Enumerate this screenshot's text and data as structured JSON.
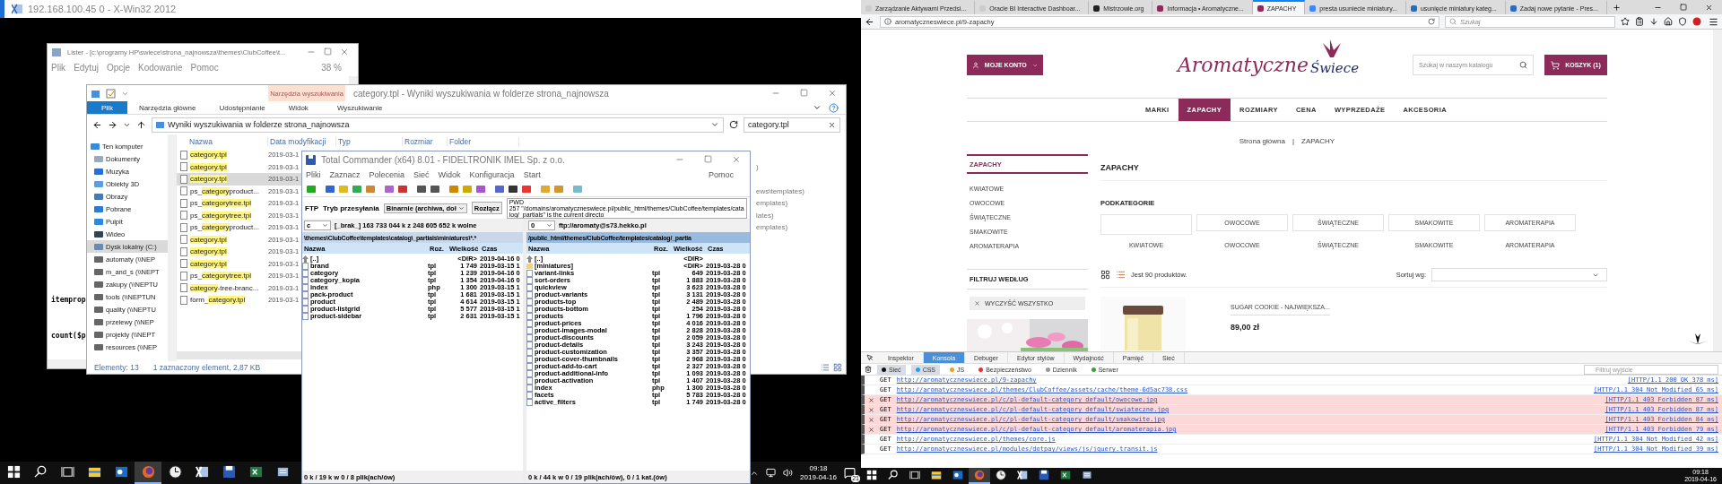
{
  "left_screen": {
    "xwin_title": "192.168.100.45 0 - X-Win32 2012",
    "lister": {
      "title": "Lister - [c:\\programy HP\\swiece\\strona_najnowsza\\themes\\ClubCoffee\\t...",
      "menu": [
        "Plik",
        "Edytuj",
        "Opcje",
        "Kodowanie",
        "Pomoc"
      ],
      "zoom": "38 %",
      "lines": [
        "itemprop",
        "count($p"
      ]
    },
    "explorer": {
      "title": "category.tpl - Wyniki wyszukiwania w folderze strona_najnowsza",
      "context_group": "Narzędzia wyszukiwania",
      "ribbon_tabs": [
        {
          "label": "Plik",
          "selected": true
        },
        {
          "label": "Narzędzia główne",
          "selected": false
        },
        {
          "label": "Udostępnianie",
          "selected": false
        },
        {
          "label": "Widok",
          "selected": false
        },
        {
          "label": "Wyszukiwanie",
          "selected": false
        }
      ],
      "address": "Wyniki wyszukiwania w folderze strona_najnowsza",
      "search": "category.tpl",
      "nav": [
        {
          "label": "Ten komputer",
          "kind": "pc",
          "selected": false,
          "children": [
            {
              "label": "Dokumenty",
              "kind": "docs",
              "selected": false
            },
            {
              "label": "Muzyka",
              "kind": "music",
              "selected": false
            },
            {
              "label": "Obiekty 3D",
              "kind": "cube",
              "selected": false
            },
            {
              "label": "Obrazy",
              "kind": "pictures",
              "selected": false
            },
            {
              "label": "Pobrane",
              "kind": "downloads",
              "selected": false
            },
            {
              "label": "Pulpit",
              "kind": "desktop",
              "selected": false
            },
            {
              "label": "Wideo",
              "kind": "video",
              "selected": false
            },
            {
              "label": "Dysk lokalny (C:)",
              "kind": "drive",
              "selected": true
            },
            {
              "label": "automaty (\\\\NEP",
              "kind": "network",
              "selected": false
            },
            {
              "label": "m_and_s (\\\\NEPT",
              "kind": "network",
              "selected": false
            },
            {
              "label": "zakupy (\\\\NEPTU",
              "kind": "network",
              "selected": false
            },
            {
              "label": "tools (\\\\NEPTUN",
              "kind": "network",
              "selected": false
            },
            {
              "label": "quality (\\\\NEPTU",
              "kind": "network",
              "selected": false
            },
            {
              "label": "przelewy (\\\\NEP",
              "kind": "network",
              "selected": false
            },
            {
              "label": "projekty (\\\\NEPT",
              "kind": "network",
              "selected": false
            },
            {
              "label": "resources (\\\\NEP",
              "kind": "network",
              "selected": false
            }
          ]
        }
      ],
      "columns": [
        "Nazwa",
        "Data modyfikacji",
        "Typ",
        "Rozmiar",
        "Folder"
      ],
      "rows": [
        {
          "name": [
            {
              "text": "category.tpl",
              "hl": true
            }
          ],
          "date": "2019-03-1",
          "selected": false
        },
        {
          "name": [
            {
              "text": "category.tpl",
              "hl": true
            }
          ],
          "date": "2019-03-1",
          "folder_tail": ")",
          "selected": false
        },
        {
          "name": [
            {
              "text": "category.tpl",
              "hl": true
            }
          ],
          "date": "2019-03-1",
          "selected": true
        },
        {
          "name": [
            {
              "text": "ps_",
              "hl": false
            },
            {
              "text": "category",
              "hl": true
            },
            {
              "text": "product...",
              "hl": false
            }
          ],
          "date": "2019-03-1",
          "folder_tail": "ews\\templates)",
          "selected": false
        },
        {
          "name": [
            {
              "text": "ps_",
              "hl": false
            },
            {
              "text": "categorytree.tpl",
              "hl": true
            }
          ],
          "date": "2019-03-1",
          "folder_tail": "emplates)",
          "selected": false
        },
        {
          "name": [
            {
              "text": "ps_",
              "hl": false
            },
            {
              "text": "categorytree.tpl",
              "hl": true
            }
          ],
          "date": "2019-03-1",
          "folder_tail": "lates)",
          "selected": false
        },
        {
          "name": [
            {
              "text": "ps_",
              "hl": false
            },
            {
              "text": "category",
              "hl": true
            },
            {
              "text": "product...",
              "hl": false
            }
          ],
          "date": "2019-03-1",
          "folder_tail": "emplates)",
          "selected": false
        },
        {
          "name": [
            {
              "text": "category.tpl",
              "hl": true
            }
          ],
          "date": "2019-03-1",
          "selected": false
        },
        {
          "name": [
            {
              "text": "category.tpl",
              "hl": true
            }
          ],
          "date": "2019-03-1",
          "selected": false
        },
        {
          "name": [
            {
              "text": "category.tpl",
              "hl": true
            }
          ],
          "date": "2019-03-1",
          "selected": false
        },
        {
          "name": [
            {
              "text": "ps_",
              "hl": false
            },
            {
              "text": "categorytree.tpl",
              "hl": true
            }
          ],
          "date": "2019-03-1",
          "selected": false
        },
        {
          "name": [
            {
              "text": "category",
              "hl": true
            },
            {
              "text": "-tree-branc...",
              "hl": false
            }
          ],
          "date": "2019-03-1",
          "selected": false
        },
        {
          "name": [
            {
              "text": "form_",
              "hl": false
            },
            {
              "text": "category.tpl",
              "hl": true
            }
          ],
          "date": "2019-03-1",
          "selected": false
        }
      ],
      "status": [
        "Elementy: 13",
        "1 zaznaczony element, 2,87 KB"
      ]
    },
    "total_commander": {
      "title": "Total Commander (x64) 8.01 - FIDELTRONIK IMEL Sp. z o.o.",
      "menu": [
        "Pliki",
        "Zaznacz",
        "Polecenia",
        "Sieć",
        "Widok",
        "Konfiguracja",
        "Start"
      ],
      "help": "Pomoc",
      "ftp": {
        "label": "FTP",
        "mode_label": "Tryb przesyłania",
        "mode": "Binarnie (archiwa, doł",
        "disconnect": "Rozłącz",
        "log": [
          "PWD",
          "257 \"/domains/aromatyczneswiece.pl/public_html/themes/ClubCoffee/templates/catalog/_partials\" is the current directo"
        ]
      },
      "panels": [
        {
          "drive": "c",
          "info": "[_brak_]  163 733 044 k z 248 605 652 k wolne",
          "path": "\\themes\\ClubCoffee\\templates\\catalog\\_partials\\miniatures\\*.*",
          "active": false,
          "columns": [
            "Nazwa",
            "Roz.",
            "Wielkość",
            "Czas"
          ],
          "files": [
            {
              "name": "[..]",
              "kind": "up",
              "size": "<DIR>",
              "time": "2019-04-16 0"
            },
            {
              "name": "brand",
              "kind": "file",
              "ext": "tpl",
              "size": "1 749",
              "time": "2019-03-15 1"
            },
            {
              "name": "category",
              "kind": "file",
              "ext": "tpl",
              "size": "1 239",
              "time": "2019-04-16 0"
            },
            {
              "name": "category_kopia",
              "kind": "file",
              "ext": "tpl",
              "size": "1 354",
              "time": "2019-04-16 0"
            },
            {
              "name": "index",
              "kind": "file",
              "ext": "php",
              "size": "1 300",
              "time": "2019-03-15 1"
            },
            {
              "name": "pack-product",
              "kind": "file",
              "ext": "tpl",
              "size": "1 681",
              "time": "2019-03-15 1"
            },
            {
              "name": "product",
              "kind": "file",
              "ext": "tpl",
              "size": "4 614",
              "time": "2019-03-15 1"
            },
            {
              "name": "product-listgrid",
              "kind": "file",
              "ext": "tpl",
              "size": "5 577",
              "time": "2019-03-15 1"
            },
            {
              "name": "product-sidebar",
              "kind": "file",
              "ext": "tpl",
              "size": "2 631",
              "time": "2019-03-15 1"
            }
          ],
          "status": "0 k / 19 k w 0 / 8 plik(ach/ów)"
        },
        {
          "drive": "0",
          "info": "ftp://aromaty@s73.hekko.pl",
          "path": "/public_html/themes/ClubCoffee/templates/catalog/_partia",
          "active": true,
          "columns": [
            "Nazwa",
            "Roz.",
            "Wielkość",
            "Czas"
          ],
          "files": [
            {
              "name": "[..]",
              "kind": "up",
              "size": "<DIR>"
            },
            {
              "name": "[miniatures]",
              "kind": "folder",
              "size": "<DIR>",
              "time": "2019-03-28 0"
            },
            {
              "name": "variant-links",
              "kind": "file",
              "ext": "tpl",
              "size": "649",
              "time": "2019-03-28 0"
            },
            {
              "name": "sort-orders",
              "kind": "file",
              "ext": "tpl",
              "size": "1 883",
              "time": "2019-03-28 0"
            },
            {
              "name": "quickview",
              "kind": "file",
              "ext": "tpl",
              "size": "3 623",
              "time": "2019-03-28 0"
            },
            {
              "name": "product-variants",
              "kind": "file",
              "ext": "tpl",
              "size": "3 131",
              "time": "2019-03-28 0"
            },
            {
              "name": "products-top",
              "kind": "file",
              "ext": "tpl",
              "size": "2 489",
              "time": "2019-03-28 0"
            },
            {
              "name": "products-bottom",
              "kind": "file",
              "ext": "tpl",
              "size": "254",
              "time": "2019-03-28 0"
            },
            {
              "name": "products",
              "kind": "file",
              "ext": "tpl",
              "size": "1 796",
              "time": "2019-03-28 0"
            },
            {
              "name": "product-prices",
              "kind": "file",
              "ext": "tpl",
              "size": "4 016",
              "time": "2019-03-28 0"
            },
            {
              "name": "product-images-modal",
              "kind": "file",
              "ext": "tpl",
              "size": "2 828",
              "time": "2019-03-28 0"
            },
            {
              "name": "product-discounts",
              "kind": "file",
              "ext": "tpl",
              "size": "2 059",
              "time": "2019-03-28 0"
            },
            {
              "name": "product-details",
              "kind": "file",
              "ext": "tpl",
              "size": "3 243",
              "time": "2019-03-28 0"
            },
            {
              "name": "product-customization",
              "kind": "file",
              "ext": "tpl",
              "size": "3 357",
              "time": "2019-03-28 0"
            },
            {
              "name": "product-cover-thumbnails",
              "kind": "file",
              "ext": "tpl",
              "size": "2 968",
              "time": "2019-03-28 0"
            },
            {
              "name": "product-add-to-cart",
              "kind": "file",
              "ext": "tpl",
              "size": "2 327",
              "time": "2019-03-28 0"
            },
            {
              "name": "product-additional-info",
              "kind": "file",
              "ext": "tpl",
              "size": "1 093",
              "time": "2019-03-28 0"
            },
            {
              "name": "product-activation",
              "kind": "file",
              "ext": "tpl",
              "size": "1 407",
              "time": "2019-03-28 0"
            },
            {
              "name": "index",
              "kind": "file",
              "ext": "php",
              "size": "1 300",
              "time": "2019-03-28 0"
            },
            {
              "name": "facets",
              "kind": "file",
              "ext": "tpl",
              "size": "5 783",
              "time": "2019-03-28 0"
            },
            {
              "name": "active_filters",
              "kind": "file",
              "ext": "tpl",
              "size": "1 749",
              "time": "2019-03-28 0"
            }
          ],
          "status": "0 k / 44 k w 0 / 19 plik(ach/ów), 0 / 1 kat.(ów)"
        }
      ]
    },
    "taskbar": {
      "apps": [
        {
          "kind": "start",
          "selected": false
        },
        {
          "kind": "search",
          "selected": false
        },
        {
          "kind": "taskview",
          "selected": false
        },
        {
          "kind": "explorer",
          "selected": false
        },
        {
          "kind": "outlook",
          "selected": false
        },
        {
          "kind": "firefox",
          "selected": true
        },
        {
          "kind": "clock",
          "selected": false
        },
        {
          "kind": "xwin",
          "selected": false
        },
        {
          "kind": "tc",
          "selected": false
        },
        {
          "kind": "excel",
          "selected": false
        },
        {
          "kind": "lister",
          "selected": false
        }
      ],
      "time": "09:18",
      "date": "2019-04-16",
      "notifications": "21"
    }
  },
  "browser": {
    "tabs": [
      {
        "label": "Zarządzanie Aktywami Przedsi...",
        "selected": false,
        "color": "#cccccc"
      },
      {
        "label": "Oracle BI Interactive Dashboar...",
        "selected": false,
        "color": "#cccccc"
      },
      {
        "label": "Mistrzowie.org",
        "selected": false,
        "color": "#222222"
      },
      {
        "label": "Informacja • Aromatyczne...",
        "selected": false,
        "color": "#8c2a5a"
      },
      {
        "label": "ZAPACHY",
        "selected": true,
        "color": "#8c2a5a"
      },
      {
        "label": "presta usuniecie miniatury...",
        "selected": false,
        "color": "#4285f4"
      },
      {
        "label": "usunięcie miniatury kateg...",
        "selected": false,
        "color": "#2a6ebb"
      },
      {
        "label": "Zadaj nowe pytanie - Pres...",
        "selected": false,
        "color": "#2a6ebb"
      }
    ],
    "url": "aromatyczneswiece.pl/9-zapachy",
    "search_placeholder": "Szukaj",
    "page": {
      "account": "MOJE KONTO",
      "logo": [
        "Aromatyczne",
        "Świece"
      ],
      "search_placeholder": "Szukaj w naszym katalogu",
      "cart": "KOSZYK (1)",
      "nav": [
        {
          "label": "MARKI",
          "selected": false
        },
        {
          "label": "ZAPACHY",
          "selected": true
        },
        {
          "label": "ROZMIARY",
          "selected": false
        },
        {
          "label": "CENA",
          "selected": false
        },
        {
          "label": "WYPRZEDAŻE",
          "selected": false
        },
        {
          "label": "AKCESORIA",
          "selected": false
        }
      ],
      "breadcrumb": {
        "items": [
          "Strona główna",
          "ZAPACHY"
        ],
        "separator": "|"
      },
      "sidebar": {
        "title": "ZAPACHY",
        "items": [
          "KWIATOWE",
          "OWOCOWE",
          "ŚWIĄTECZNE",
          "SMAKOWITE",
          "AROMATERAPIA"
        ],
        "filter_title": "FILTRUJ WEDŁUG",
        "clear": "WYCZYŚĆ WSZYSTKO"
      },
      "title": "ZAPACHY",
      "subcategories_title": "PODKATEGORIE",
      "subcategories": [
        {
          "name": "KWIATOWE"
        },
        {
          "name": "OWOCOWE",
          "alt": "OWOCOWE"
        },
        {
          "name": "ŚWIĄTECZNE",
          "alt": "ŚWIĄTECZNE"
        },
        {
          "name": "SMAKOWITE",
          "alt": "SMAKOWITE"
        },
        {
          "name": "AROMATERAPIA",
          "alt": "AROMATERAPIA"
        }
      ],
      "count": "Jest 90 produktów.",
      "sort_label": "Sortuj wg:",
      "product": {
        "name": "SUGAR COOKIE - NAJWIĘKSZA...",
        "price": "89,00 zł"
      }
    },
    "devtools": {
      "tabs": [
        {
          "label": "Inspektor",
          "selected": false
        },
        {
          "label": "Konsola",
          "selected": true
        },
        {
          "label": "Debuger",
          "selected": false
        },
        {
          "label": "Edytor stylów",
          "selected": false
        },
        {
          "label": "Wydajność",
          "selected": false
        },
        {
          "label": "Pamięć",
          "selected": false
        },
        {
          "label": "Sieć",
          "selected": false
        }
      ],
      "filters": [
        {
          "label": "Sieć",
          "on": true,
          "color": "#111111"
        },
        {
          "label": "CSS",
          "on": true,
          "color": "#2a9ee8"
        },
        {
          "label": "JS",
          "on": false,
          "color": "#f0a020"
        },
        {
          "label": "Bezpieczeństwo",
          "on": false,
          "color": "#e83030"
        },
        {
          "label": "Dziennik",
          "on": false,
          "color": "#999999"
        },
        {
          "label": "Serwer",
          "on": false,
          "color": "#3aa040"
        }
      ],
      "filter_placeholder": "Filtruj wyjście",
      "logs": [
        {
          "method": "GET",
          "url": "http://aromatyczneswiece.pl/9-zapachy",
          "status": "[HTTP/1.1 200 OK 378 ms]",
          "error": false
        },
        {
          "method": "GET",
          "url": "http://aromatyczneswiece.pl/themes/ClubCoffee/assets/cache/theme-6d5ac738.css",
          "status": "[HTTP/1.1 304 Not Modified 65 ms]",
          "error": false
        },
        {
          "method": "GET",
          "url": "http://aromatyczneswiece.pl/c/pl-default-category_default/owocowe.jpg",
          "status": "[HTTP/1.1 403 Forbidden 87 ms]",
          "error": true
        },
        {
          "method": "GET",
          "url": "http://aromatyczneswiece.pl/c/pl-default-category_default/swiateczne.jpg",
          "status": "[HTTP/1.1 403 Forbidden 87 ms]",
          "error": true
        },
        {
          "method": "GET",
          "url": "http://aromatyczneswiece.pl/c/pl-default-category_default/smakowite.jpg",
          "status": "[HTTP/1.1 403 Forbidden 84 ms]",
          "error": true
        },
        {
          "method": "GET",
          "url": "http://aromatyczneswiece.pl/c/pl-default-category_default/aromaterapia.jpg",
          "status": "[HTTP/1.1 403 Forbidden 79 ms]",
          "error": true
        },
        {
          "method": "GET",
          "url": "http://aromatyczneswiece.pl/themes/core.js",
          "status": "[HTTP/1.1 304 Not Modified 42 ms]",
          "error": false
        },
        {
          "method": "GET",
          "url": "http://aromatyczneswiece.pl/modules/dotpay/views/js/jquery.transit.js",
          "status": "[HTTP/1.1 304 Not Modified 39 ms]",
          "error": false
        }
      ]
    },
    "taskbar": {
      "apps": [
        {
          "kind": "start",
          "selected": false
        },
        {
          "kind": "search",
          "selected": false
        },
        {
          "kind": "taskview",
          "selected": false
        },
        {
          "kind": "explorer",
          "selected": false
        },
        {
          "kind": "outlook",
          "selected": false
        },
        {
          "kind": "firefox",
          "selected": true
        },
        {
          "kind": "clock",
          "selected": false
        },
        {
          "kind": "xwin",
          "selected": false
        },
        {
          "kind": "tc",
          "selected": false
        },
        {
          "kind": "excel",
          "selected": false
        },
        {
          "kind": "lister",
          "selected": false
        }
      ],
      "time": "09:18",
      "date": "2019-04-16"
    }
  }
}
